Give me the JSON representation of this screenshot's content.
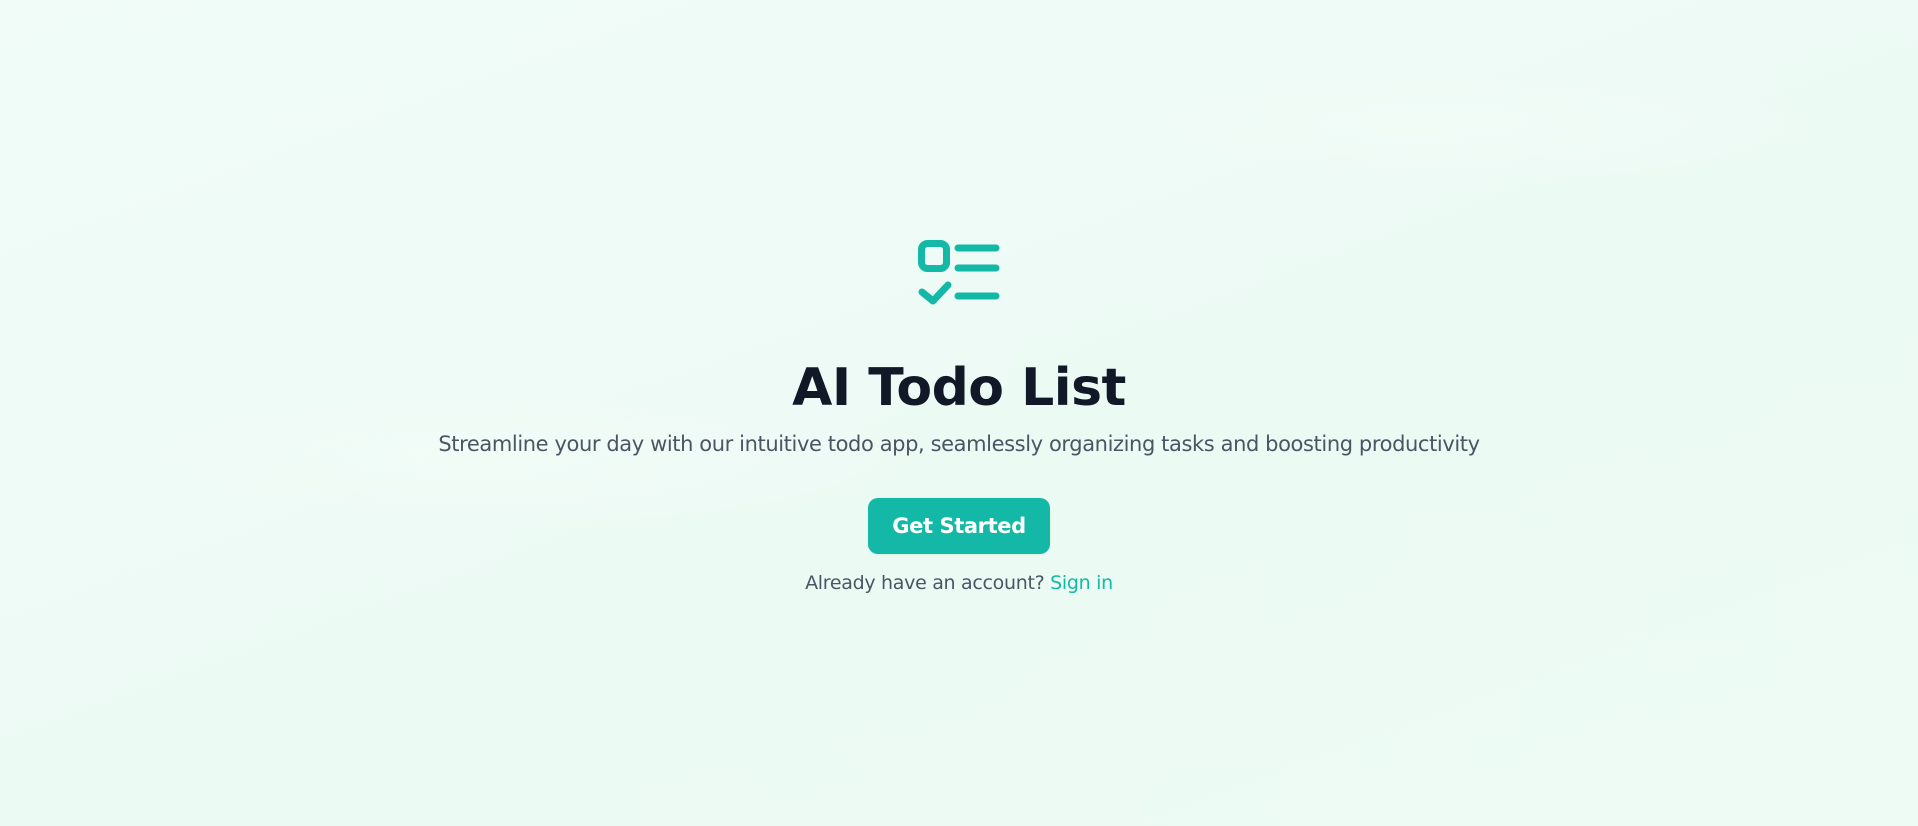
{
  "colors": {
    "accent": "#14b8a6",
    "title": "#111827",
    "muted": "#4b5563",
    "background": "#f0fcf8"
  },
  "logo": {
    "icon": "checklist-icon"
  },
  "hero": {
    "title": "AI Todo List",
    "subtitle": "Streamline your day with our intuitive todo app, seamlessly organizing tasks and boosting productivity",
    "cta_label": "Get Started"
  },
  "signin": {
    "prompt": "Already have an account?",
    "link_label": "Sign in"
  }
}
